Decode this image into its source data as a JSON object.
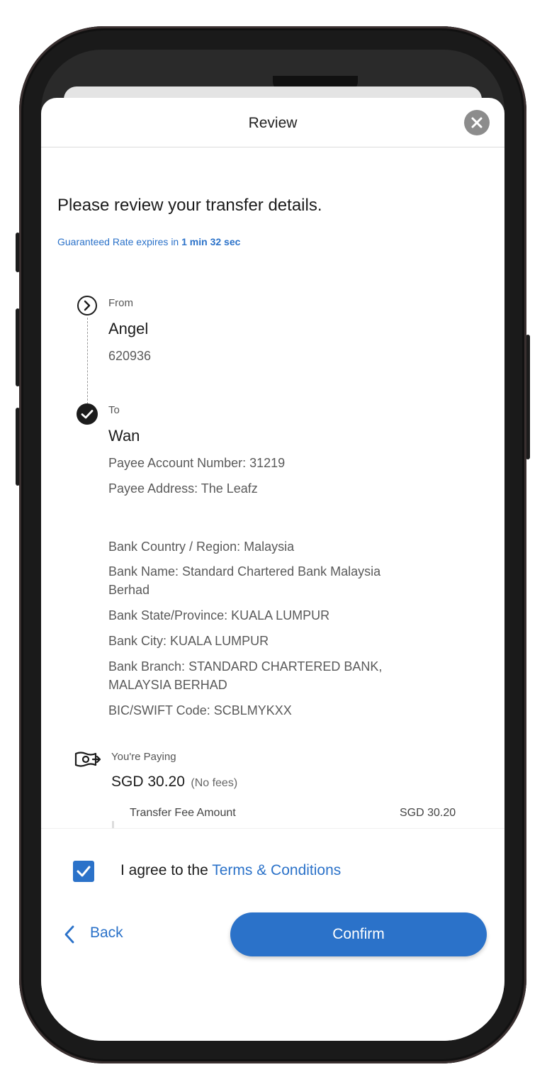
{
  "header": {
    "title": "Review"
  },
  "intro": {
    "title": "Please review your transfer details.",
    "rate_prefix": "Guaranteed Rate expires in ",
    "rate_time": "1 min 32 sec"
  },
  "from": {
    "label": "From",
    "name": "Angel",
    "account": "620936"
  },
  "to": {
    "label": "To",
    "name": "Wan",
    "account_number": "Payee Account Number: 31219",
    "address": "Payee Address: The Leafz",
    "bank_country": "Bank Country / Region: Malaysia",
    "bank_name": "Bank Name: Standard Chartered Bank Malaysia Berhad",
    "bank_state": "Bank State/Province: KUALA LUMPUR",
    "bank_city": "Bank City: KUALA LUMPUR",
    "bank_branch": "Bank Branch: STANDARD CHARTERED BANK, MALAYSIA BERHAD",
    "swift": "BIC/SWIFT Code: SCBLMYKXX"
  },
  "paying": {
    "label": "You're Paying",
    "amount": "SGD 30.20",
    "fees_note": "(No fees)",
    "fee_label": "Transfer Fee Amount",
    "fee_value": "SGD 30.20"
  },
  "footer": {
    "agree_prefix": "I agree to the ",
    "terms_link": "Terms & Conditions",
    "back_label": "Back",
    "confirm_label": "Confirm"
  },
  "colors": {
    "accent": "#2b72c9"
  }
}
